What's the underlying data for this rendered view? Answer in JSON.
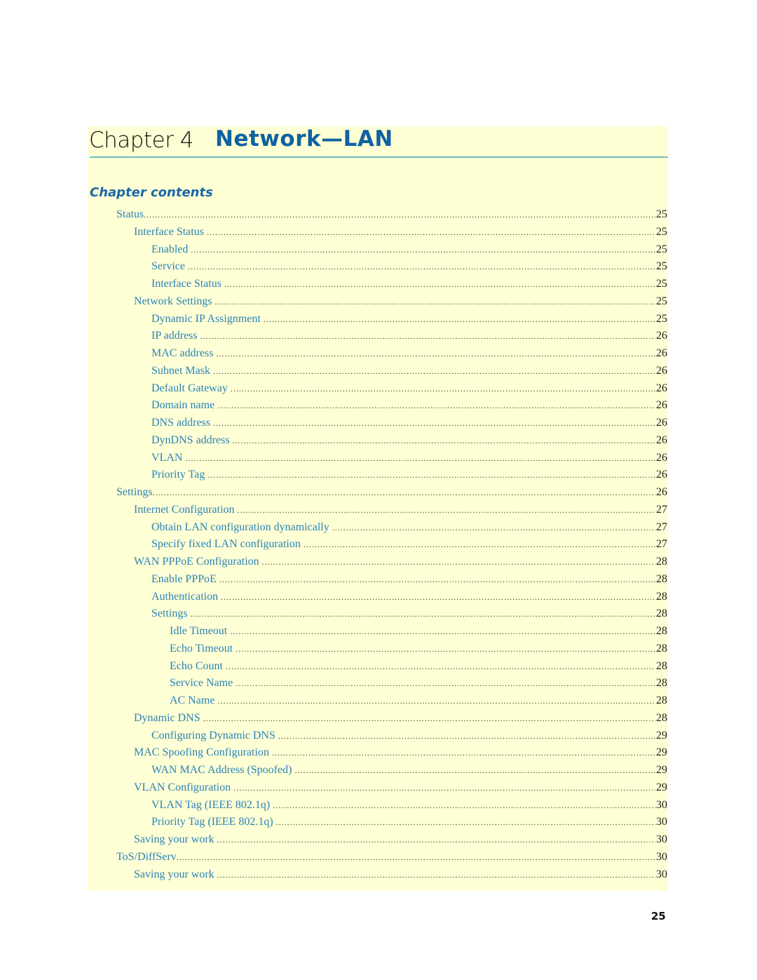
{
  "chapter": {
    "label": "Chapter 4",
    "title": "Network—LAN"
  },
  "contents_heading": "Chapter contents",
  "toc": [
    {
      "text": "Status",
      "page": "25",
      "level": 1
    },
    {
      "text": "Interface Status",
      "page": "25",
      "level": 2
    },
    {
      "text": "Enabled",
      "page": "25",
      "level": 3
    },
    {
      "text": "Service",
      "page": "25",
      "level": 3
    },
    {
      "text": "Interface Status",
      "page": "25",
      "level": 3
    },
    {
      "text": "Network Settings",
      "page": "25",
      "level": 2
    },
    {
      "text": "Dynamic IP Assignment",
      "page": "25",
      "level": 3
    },
    {
      "text": "IP address",
      "page": "26",
      "level": 3
    },
    {
      "text": "MAC address",
      "page": "26",
      "level": 3
    },
    {
      "text": "Subnet Mask",
      "page": "26",
      "level": 3
    },
    {
      "text": "Default Gateway",
      "page": "26",
      "level": 3
    },
    {
      "text": "Domain name",
      "page": "26",
      "level": 3
    },
    {
      "text": "DNS address",
      "page": "26",
      "level": 3
    },
    {
      "text": "DynDNS address",
      "page": "26",
      "level": 3
    },
    {
      "text": "VLAN",
      "page": "26",
      "level": 3
    },
    {
      "text": "Priority Tag",
      "page": "26",
      "level": 3
    },
    {
      "text": "Settings",
      "page": "26",
      "level": 1
    },
    {
      "text": "Internet Configuration",
      "page": "27",
      "level": 2
    },
    {
      "text": "Obtain LAN configuration dynamically",
      "page": "27",
      "level": 3
    },
    {
      "text": "Specify fixed LAN configuration",
      "page": "27",
      "level": 3
    },
    {
      "text": "WAN PPPoE Configuration",
      "page": "28",
      "level": 2
    },
    {
      "text": "Enable PPPoE",
      "page": "28",
      "level": 3
    },
    {
      "text": "Authentication",
      "page": "28",
      "level": 3
    },
    {
      "text": "Settings",
      "page": "28",
      "level": 3
    },
    {
      "text": "Idle Timeout",
      "page": "28",
      "level": 4
    },
    {
      "text": "Echo Timeout",
      "page": "28",
      "level": 4
    },
    {
      "text": "Echo Count",
      "page": "28",
      "level": 4
    },
    {
      "text": "Service Name",
      "page": "28",
      "level": 4
    },
    {
      "text": "AC Name",
      "page": "28",
      "level": 4
    },
    {
      "text": "Dynamic DNS",
      "page": "28",
      "level": 2
    },
    {
      "text": "Configuring Dynamic DNS",
      "page": "29",
      "level": 3
    },
    {
      "text": "MAC Spoofing Configuration",
      "page": "29",
      "level": 2
    },
    {
      "text": "WAN MAC Address (Spoofed)",
      "page": "29",
      "level": 3
    },
    {
      "text": "VLAN Configuration",
      "page": "29",
      "level": 2
    },
    {
      "text": "VLAN Tag (IEEE 802.1q)",
      "page": "30",
      "level": 3
    },
    {
      "text": "Priority Tag (IEEE 802.1q)",
      "page": "30",
      "level": 3
    },
    {
      "text": "Saving your work",
      "page": "30",
      "level": 2
    },
    {
      "text": "ToS/DiffServ",
      "page": "30",
      "level": 1
    },
    {
      "text": "Saving your work",
      "page": "30",
      "level": 2
    }
  ],
  "page_number": "25",
  "colors": {
    "panel_background": "#ffffd5",
    "title_blue": "#0f62a3",
    "link_blue": "#2a82b8",
    "rule": "#72bcc4"
  }
}
